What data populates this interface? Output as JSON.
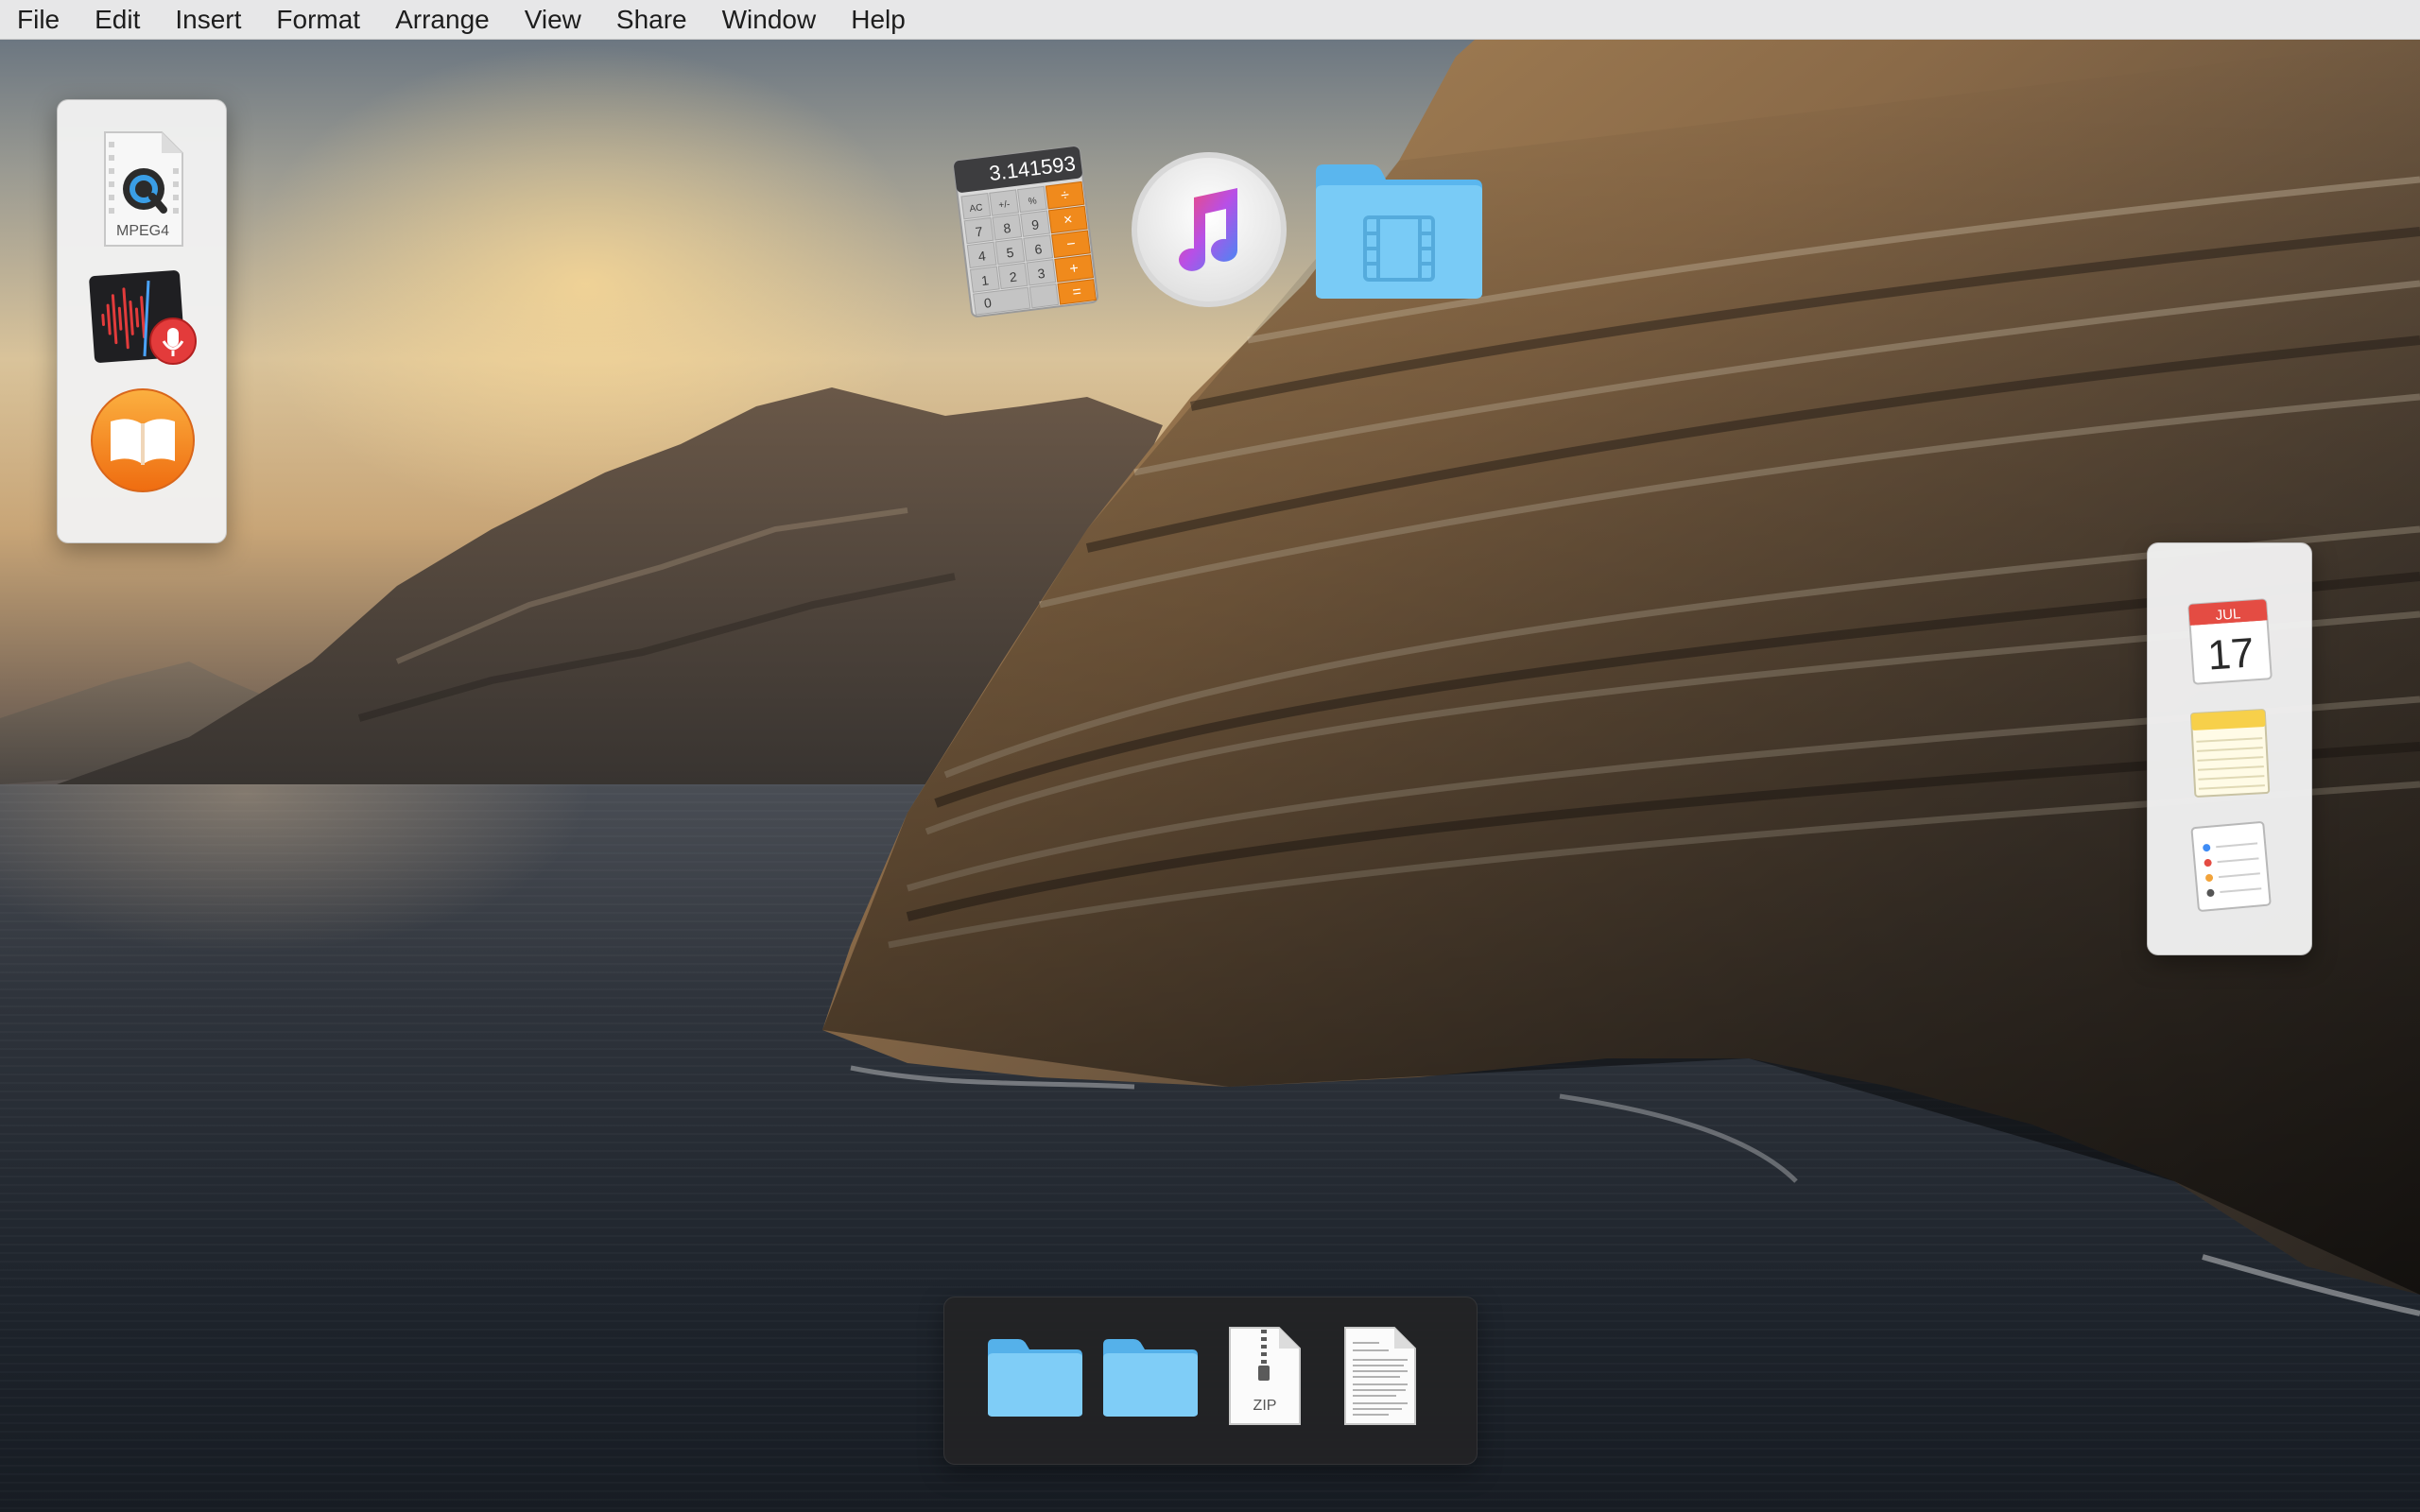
{
  "menubar": {
    "items": [
      "File",
      "Edit",
      "Insert",
      "Format",
      "Arrange",
      "View",
      "Share",
      "Window",
      "Help"
    ]
  },
  "left_panel": {
    "items": [
      {
        "name": "mpeg4-quicktime-file",
        "icon": "quicktime-mpeg4-icon",
        "caption": "MPEG4"
      },
      {
        "name": "voice-memos-app",
        "icon": "waveform-microphone-icon"
      },
      {
        "name": "books-app",
        "icon": "open-book-icon"
      }
    ]
  },
  "desktop_icons": [
    {
      "name": "calculator-app",
      "icon": "calculator-icon",
      "display": "3.141593"
    },
    {
      "name": "itunes-app",
      "icon": "music-note-icon"
    },
    {
      "name": "movies-folder",
      "icon": "film-folder-icon"
    }
  ],
  "right_panel": {
    "items": [
      {
        "name": "calendar-app",
        "icon": "calendar-icon",
        "month": "JUL",
        "day": "17"
      },
      {
        "name": "notes-app",
        "icon": "notes-icon"
      },
      {
        "name": "reminders-app",
        "icon": "reminders-list-icon"
      }
    ]
  },
  "bottom_panel": {
    "items": [
      {
        "name": "folder-1",
        "icon": "folder-icon"
      },
      {
        "name": "folder-2",
        "icon": "folder-icon"
      },
      {
        "name": "zip-archive",
        "icon": "zip-file-icon",
        "caption": "ZIP"
      },
      {
        "name": "text-document",
        "icon": "text-document-icon"
      }
    ]
  },
  "colors": {
    "folder_blue": "#6cc3f5",
    "calculator_orange": "#f08a1c",
    "books_orange": "#f7931e",
    "recorder_red": "#e33b3b"
  }
}
